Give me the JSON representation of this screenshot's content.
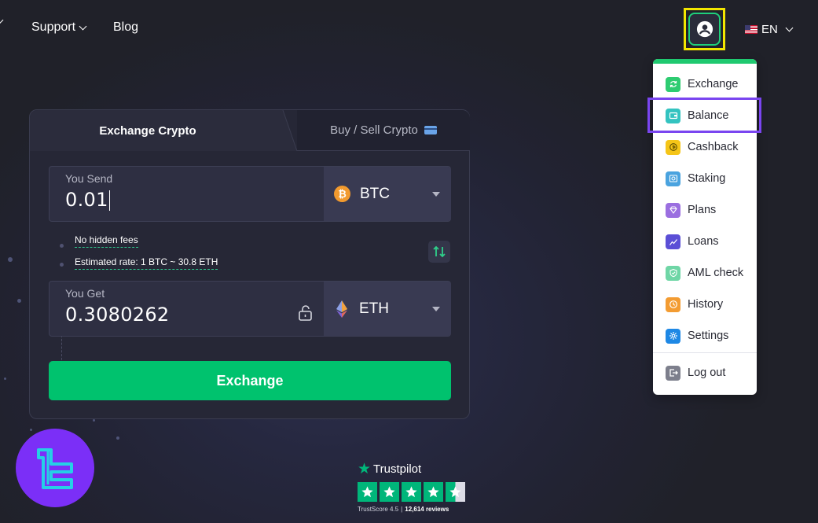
{
  "nav": {
    "support_label": "Support",
    "blog_label": "Blog",
    "language": "EN"
  },
  "tabs": {
    "exchange": "Exchange Crypto",
    "buy_sell": "Buy / Sell Crypto"
  },
  "send": {
    "label": "You Send",
    "value": "0.01",
    "currency": "BTC"
  },
  "info": {
    "fees": "No hidden fees",
    "rate": "Estimated rate: 1 BTC ~ 30.8 ETH"
  },
  "get": {
    "label": "You Get",
    "value": "0.3080262",
    "currency": "ETH"
  },
  "exchange_button": "Exchange",
  "menu": {
    "items": [
      {
        "label": "Exchange",
        "icon": "exchange-icon",
        "color": "#2ecc71"
      },
      {
        "label": "Balance",
        "icon": "wallet-icon",
        "color": "#33c3c0"
      },
      {
        "label": "Cashback",
        "icon": "cashback-icon",
        "color": "#f5c518"
      },
      {
        "label": "Staking",
        "icon": "staking-icon",
        "color": "#4aa3df"
      },
      {
        "label": "Plans",
        "icon": "diamond-icon",
        "color": "#9b6fe0"
      },
      {
        "label": "Loans",
        "icon": "chart-icon",
        "color": "#5b4fd6"
      },
      {
        "label": "AML check",
        "icon": "shield-icon",
        "color": "#6fd6a6"
      },
      {
        "label": "History",
        "icon": "history-icon",
        "color": "#f39c32"
      },
      {
        "label": "Settings",
        "icon": "gear-icon",
        "color": "#1e88e5"
      }
    ],
    "logout": {
      "label": "Log out",
      "icon": "logout-icon",
      "color": "#7d7f8c"
    }
  },
  "trustpilot": {
    "brand": "Trustpilot",
    "score": "TrustScore 4.5",
    "reviews": "12,614 reviews"
  },
  "colors": {
    "accent": "#00c26e",
    "highlight_user": "#f2e600",
    "highlight_balance": "#7a45f0",
    "logo": "#7b2ff7"
  }
}
